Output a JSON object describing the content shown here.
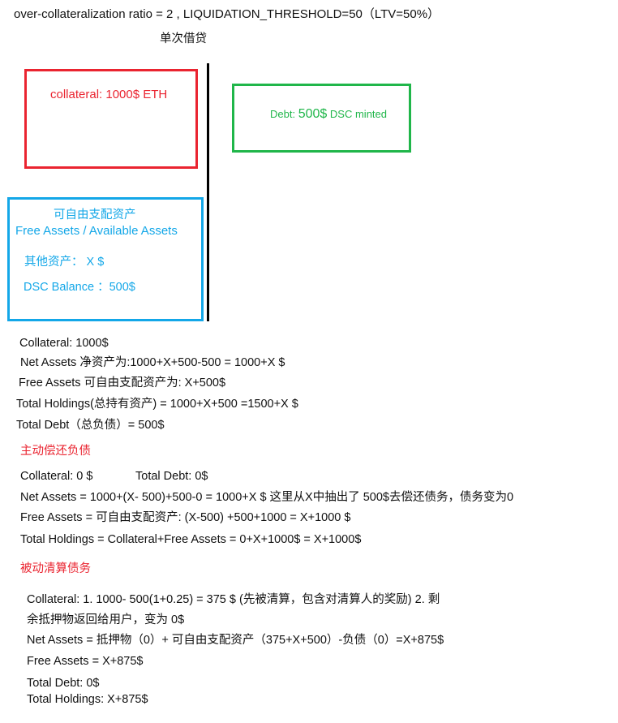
{
  "header": {
    "title": "over-collateralization ratio  = 2 , LIQUIDATION_THRESHOLD=50（LTV=50%）",
    "subtitle": "单次借贷"
  },
  "diagram": {
    "collateral_box": {
      "label": "collateral: 1000$ ETH",
      "color": "#ea2430"
    },
    "debt_box": {
      "label_prefix": "Debt:",
      "amount": "500$",
      "label_suffix": "DSC  minted",
      "color": "#20b64a"
    },
    "free_box": {
      "title_cn": "可自由支配资产",
      "title_en": "Free Assets / Available Assets",
      "other_assets": "其他资产：  X $",
      "dsc_balance": "DSC Balance   ：500$",
      "color": "#13a7e8"
    }
  },
  "initial": [
    "Collateral: 1000$",
    "Net Assets 净资产为:1000+X+500-500 = 1000+X $",
    "Free Assets 可自由支配资产为:  X+500$",
    "Total Holdings(总持有资产) = 1000+X+500 =1500+X $",
    "Total Debt（总负债）= 500$"
  ],
  "repay": {
    "heading": "主动偿还负债",
    "collateral": "Collateral: 0 $",
    "total_debt": "Total Debt: 0$",
    "lines": [
      "Net Assets =  1000+(X-  500)+500-0 = 1000+X $    这里从X中抽出了  500$去偿还债务，债务变为0",
      "Free Assets = 可自由支配资产: (X-500) +500+1000 =  X+1000 $",
      "Total Holdings = Collateral+Free Assets = 0+X+1000$ = X+1000$"
    ]
  },
  "liquidation": {
    "heading": "被动清算债务",
    "lines": [
      "Collateral: 1. 1000-  500(1+0.25) =  375 $ (先被清算，包含对清算人的奖励) 2. 剩",
      "余抵押物返回给用户，变为 0$",
      "Net Assets = 抵押物（0）+ 可自由支配资产（375+X+500）-负债（0）=X+875$",
      "Free Assets = X+875$",
      "Total Debt: 0$",
      "Total Holdings:  X+875$"
    ]
  }
}
